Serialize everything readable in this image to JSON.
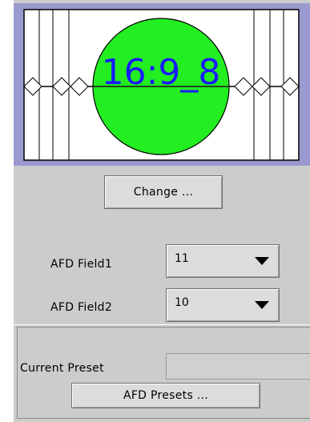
{
  "preview": {
    "aspect_label": "16:9_8",
    "circle_color": "#22ee22",
    "text_color": "#1a1aff",
    "background_color": "#9a9ad0"
  },
  "change_button": {
    "label": "Change ..."
  },
  "afd_field1": {
    "label": "AFD Field1",
    "value": "11"
  },
  "afd_field2": {
    "label": "AFD Field2",
    "value": "10"
  },
  "preset": {
    "current_label": "Current Preset",
    "current_value": "",
    "presets_button_label": "AFD Presets ..."
  }
}
